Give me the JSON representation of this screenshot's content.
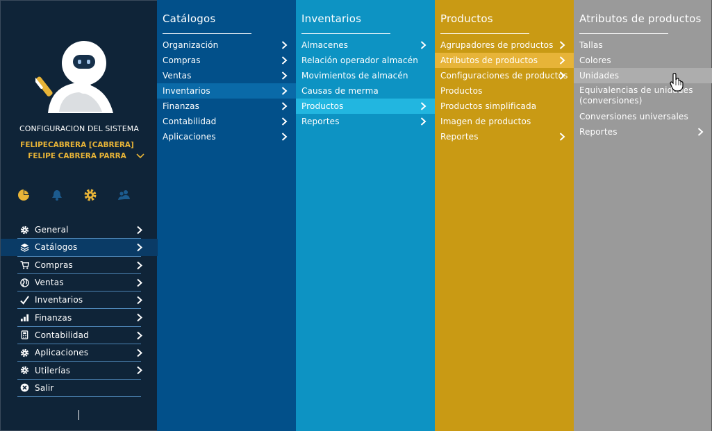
{
  "sidebar": {
    "system_title": "CONFIGURACION DEL SISTEMA",
    "user_short": "FELIPECABRERA [CABRERA]",
    "user_full": "FELIPE CABRERA PARRA",
    "toolbar_icons": [
      "dashboard-icon",
      "bell-icon",
      "gear-icon",
      "users-icon"
    ],
    "items": [
      {
        "label": "General",
        "icon": "gear-icon"
      },
      {
        "label": "Catálogos",
        "icon": "layers-icon"
      },
      {
        "label": "Compras",
        "icon": "cart-icon"
      },
      {
        "label": "Ventas",
        "icon": "globe-icon"
      },
      {
        "label": "Inventarios",
        "icon": "checkmark-icon"
      },
      {
        "label": "Finanzas",
        "icon": "bar-chart-icon"
      },
      {
        "label": "Contabilidad",
        "icon": "calculator-icon"
      },
      {
        "label": "Aplicaciones",
        "icon": "gear-icon"
      },
      {
        "label": "Utilerías",
        "icon": "gear-icon"
      },
      {
        "label": "Salir",
        "icon": "close-circle-icon"
      }
    ],
    "active_item": "Catálogos"
  },
  "columns": [
    {
      "title": "Catálogos",
      "items": [
        {
          "label": "Organización",
          "arrow": true
        },
        {
          "label": "Compras",
          "arrow": true
        },
        {
          "label": "Ventas",
          "arrow": true
        },
        {
          "label": "Inventarios",
          "arrow": true,
          "highlighted": true
        },
        {
          "label": "Finanzas",
          "arrow": true
        },
        {
          "label": "Contabilidad",
          "arrow": true
        },
        {
          "label": "Aplicaciones",
          "arrow": true
        }
      ]
    },
    {
      "title": "Inventarios",
      "items": [
        {
          "label": "Almacenes",
          "arrow": true
        },
        {
          "label": "Relación operador almacén",
          "arrow": false
        },
        {
          "label": "Movimientos de almacén",
          "arrow": false
        },
        {
          "label": "Causas de merma",
          "arrow": false
        },
        {
          "label": "Productos",
          "arrow": true,
          "highlighted": true
        },
        {
          "label": "Reportes",
          "arrow": true
        }
      ]
    },
    {
      "title": "Productos",
      "items": [
        {
          "label": "Agrupadores de productos",
          "arrow": true
        },
        {
          "label": "Atributos de productos",
          "arrow": true,
          "highlighted": true
        },
        {
          "label": "Configuraciones de productos",
          "arrow": true
        },
        {
          "label": "Productos",
          "arrow": false
        },
        {
          "label": "Productos simplificada",
          "arrow": false
        },
        {
          "label": "Imagen de productos",
          "arrow": false
        },
        {
          "label": "Reportes",
          "arrow": true
        }
      ]
    },
    {
      "title": "Atributos de productos",
      "items": [
        {
          "label": "Tallas",
          "arrow": false
        },
        {
          "label": "Colores",
          "arrow": false
        },
        {
          "label": "Unidades",
          "arrow": false,
          "highlighted": true
        },
        {
          "label": "Equivalencias de unidades (conversiones)",
          "arrow": false
        },
        {
          "label": "Conversiones universales",
          "arrow": false
        },
        {
          "label": "Reportes",
          "arrow": true
        }
      ]
    }
  ],
  "colors": {
    "sidebar_bg": "#0f2438",
    "catalogos_bg": "#02508a",
    "inventarios_bg": "#0d93c3",
    "productos_bg": "#c99a14",
    "atributos_bg": "#9a9a9a",
    "accent_gold": "#e8b437"
  }
}
